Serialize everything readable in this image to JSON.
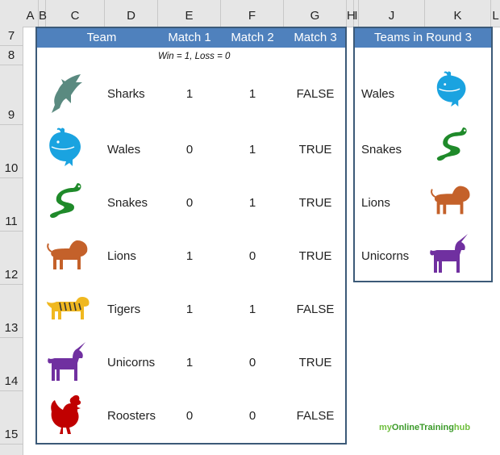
{
  "columns": [
    "A",
    "B",
    "C",
    "D",
    "E",
    "F",
    "G",
    "H",
    "I",
    "J",
    "K",
    "L"
  ],
  "rows": [
    "7",
    "8",
    "9",
    "10",
    "11",
    "12",
    "13",
    "14",
    "15"
  ],
  "main_table": {
    "headers": {
      "team": "Team",
      "m1": "Match 1",
      "m2": "Match 2",
      "m3": "Match 3"
    },
    "note": "Win = 1, Loss = 0",
    "teams": [
      {
        "name": "Sharks",
        "m1": "1",
        "m2": "1",
        "m3": "FALSE",
        "icon": "shark-icon",
        "color": "#5a8a80"
      },
      {
        "name": "Wales",
        "m1": "0",
        "m2": "1",
        "m3": "TRUE",
        "icon": "whale-icon",
        "color": "#1aa3e0"
      },
      {
        "name": "Snakes",
        "m1": "0",
        "m2": "1",
        "m3": "TRUE",
        "icon": "snake-icon",
        "color": "#1f8a2a"
      },
      {
        "name": "Lions",
        "m1": "1",
        "m2": "0",
        "m3": "TRUE",
        "icon": "lion-icon",
        "color": "#c4612a"
      },
      {
        "name": "Tigers",
        "m1": "1",
        "m2": "1",
        "m3": "FALSE",
        "icon": "tiger-icon",
        "color": "#f0b820"
      },
      {
        "name": "Unicorns",
        "m1": "1",
        "m2": "0",
        "m3": "TRUE",
        "icon": "unicorn-icon",
        "color": "#7030a0"
      },
      {
        "name": "Roosters",
        "m1": "0",
        "m2": "0",
        "m3": "FALSE",
        "icon": "rooster-icon",
        "color": "#c00000"
      }
    ]
  },
  "round3_table": {
    "header": "Teams in Round 3",
    "teams": [
      {
        "name": "Wales",
        "icon": "whale-icon",
        "color": "#1aa3e0"
      },
      {
        "name": "Snakes",
        "icon": "snake-icon",
        "color": "#1f8a2a"
      },
      {
        "name": "Lions",
        "icon": "lion-icon",
        "color": "#c4612a"
      },
      {
        "name": "Unicorns",
        "icon": "unicorn-icon",
        "color": "#7030a0"
      }
    ]
  },
  "branding": {
    "prefix": "my",
    "name": "OnlineTraining",
    "suffix": "hub"
  },
  "colors": {
    "header_fill": "#4f81bd",
    "border": "#3c5a78"
  }
}
